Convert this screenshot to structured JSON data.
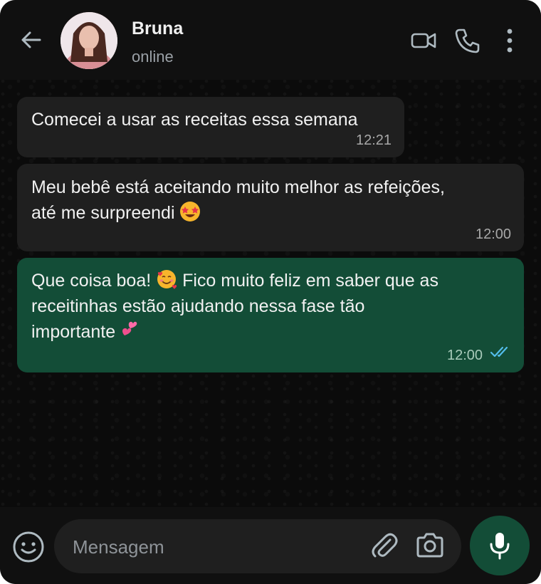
{
  "header": {
    "contact_name": "Bruna",
    "status": "online",
    "icons": [
      "back-arrow-icon",
      "video-call-icon",
      "phone-icon",
      "more-options-icon"
    ]
  },
  "messages": [
    {
      "direction": "incoming",
      "line1": "Comecei a usar as receitas essa semana",
      "time": "12:21"
    },
    {
      "direction": "incoming",
      "line1": "Meu bebê está aceitando muito melhor as refeições,",
      "line2": "até me surpreendi",
      "emoji": "star-struck-emoji",
      "time": "12:00"
    },
    {
      "direction": "outgoing",
      "part1": "Que coisa boa!",
      "emoji1": "smiling-face-with-hearts-emoji",
      "part2": "Fico muito feliz em saber que as",
      "line2": "receitinhas estão ajudando nessa fase tão",
      "line3": "importante",
      "emoji2": "two-hearts-emoji",
      "time": "12:00",
      "read_receipt": "double-check-blue"
    }
  ],
  "composer": {
    "placeholder": "Mensagem",
    "value": "",
    "icons": [
      "emoji-icon",
      "attachment-icon",
      "camera-icon",
      "microphone-icon"
    ]
  },
  "colors": {
    "background": "#0b0b0b",
    "header": "#101010",
    "incoming_bubble": "#1f1f1f",
    "outgoing_bubble": "#134d37",
    "read_tick": "#53bdeb",
    "icon": "#aebac1"
  }
}
